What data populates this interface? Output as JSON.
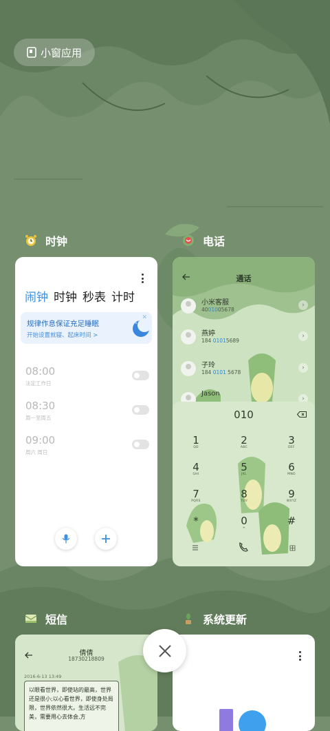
{
  "colors": {
    "background": "#76906f",
    "accent_blue": "#3a8fe0",
    "card_white": "#ffffff",
    "phone_green": "#cfe3c3"
  },
  "mini_window": {
    "label": "小窗应用",
    "icon": "mini-window-icon"
  },
  "apps": {
    "clock": {
      "label": "时钟",
      "icon": "alarm-clock-app-icon",
      "tabs": [
        "闹钟",
        "时钟",
        "秒表",
        "计时"
      ],
      "active_tab": "闹钟",
      "banner": {
        "title": "规律作息保证充足睡眠",
        "subtitle": "开始设置就寝、起床时间 >"
      },
      "alarms": [
        {
          "time": "08:00",
          "note": "法定工作日",
          "enabled": false
        },
        {
          "time": "08:30",
          "note": "周一至周五",
          "enabled": false
        },
        {
          "time": "09:00",
          "note": "周六 周日",
          "enabled": false
        }
      ]
    },
    "phone": {
      "label": "电话",
      "icon": "phone-app-icon",
      "title": "通话",
      "contacts": [
        {
          "name": "小米客服",
          "num_pre": "40",
          "num_hl": "010",
          "num_post": "05678"
        },
        {
          "name": "燕婷",
          "num_pre": "184 ",
          "num_hl": "0101",
          "num_post": "5689"
        },
        {
          "name": "子玲",
          "num_pre": "184 ",
          "num_hl": "0101",
          "num_post": " 5678"
        },
        {
          "name": "Jason",
          "num_pre": "",
          "num_hl": "",
          "num_post": ""
        }
      ],
      "dialed": "010",
      "keys": [
        {
          "d": "1",
          "l": "QD"
        },
        {
          "d": "2",
          "l": "ABC"
        },
        {
          "d": "3",
          "l": "DEF"
        },
        {
          "d": "4",
          "l": "GHI"
        },
        {
          "d": "5",
          "l": "JKL"
        },
        {
          "d": "6",
          "l": "MNO"
        },
        {
          "d": "7",
          "l": "PQRS"
        },
        {
          "d": "8",
          "l": "TUV"
        },
        {
          "d": "9",
          "l": "WXYZ"
        },
        {
          "d": "*",
          "l": ""
        },
        {
          "d": "0",
          "l": "+"
        },
        {
          "d": "#",
          "l": ""
        }
      ]
    },
    "sms": {
      "label": "短信",
      "icon": "sms-app-icon",
      "contact_name": "倩倩",
      "contact_number": "18730218809",
      "date": "2016-6-13 13:49",
      "message": "以眼看世界，即使站的最高，世界还是很小;以心看世界，即使身处局限，世界依然很大。生活远不完美，需要用心去体会,方"
    },
    "update": {
      "label": "系统更新",
      "icon": "system-update-app-icon"
    }
  }
}
